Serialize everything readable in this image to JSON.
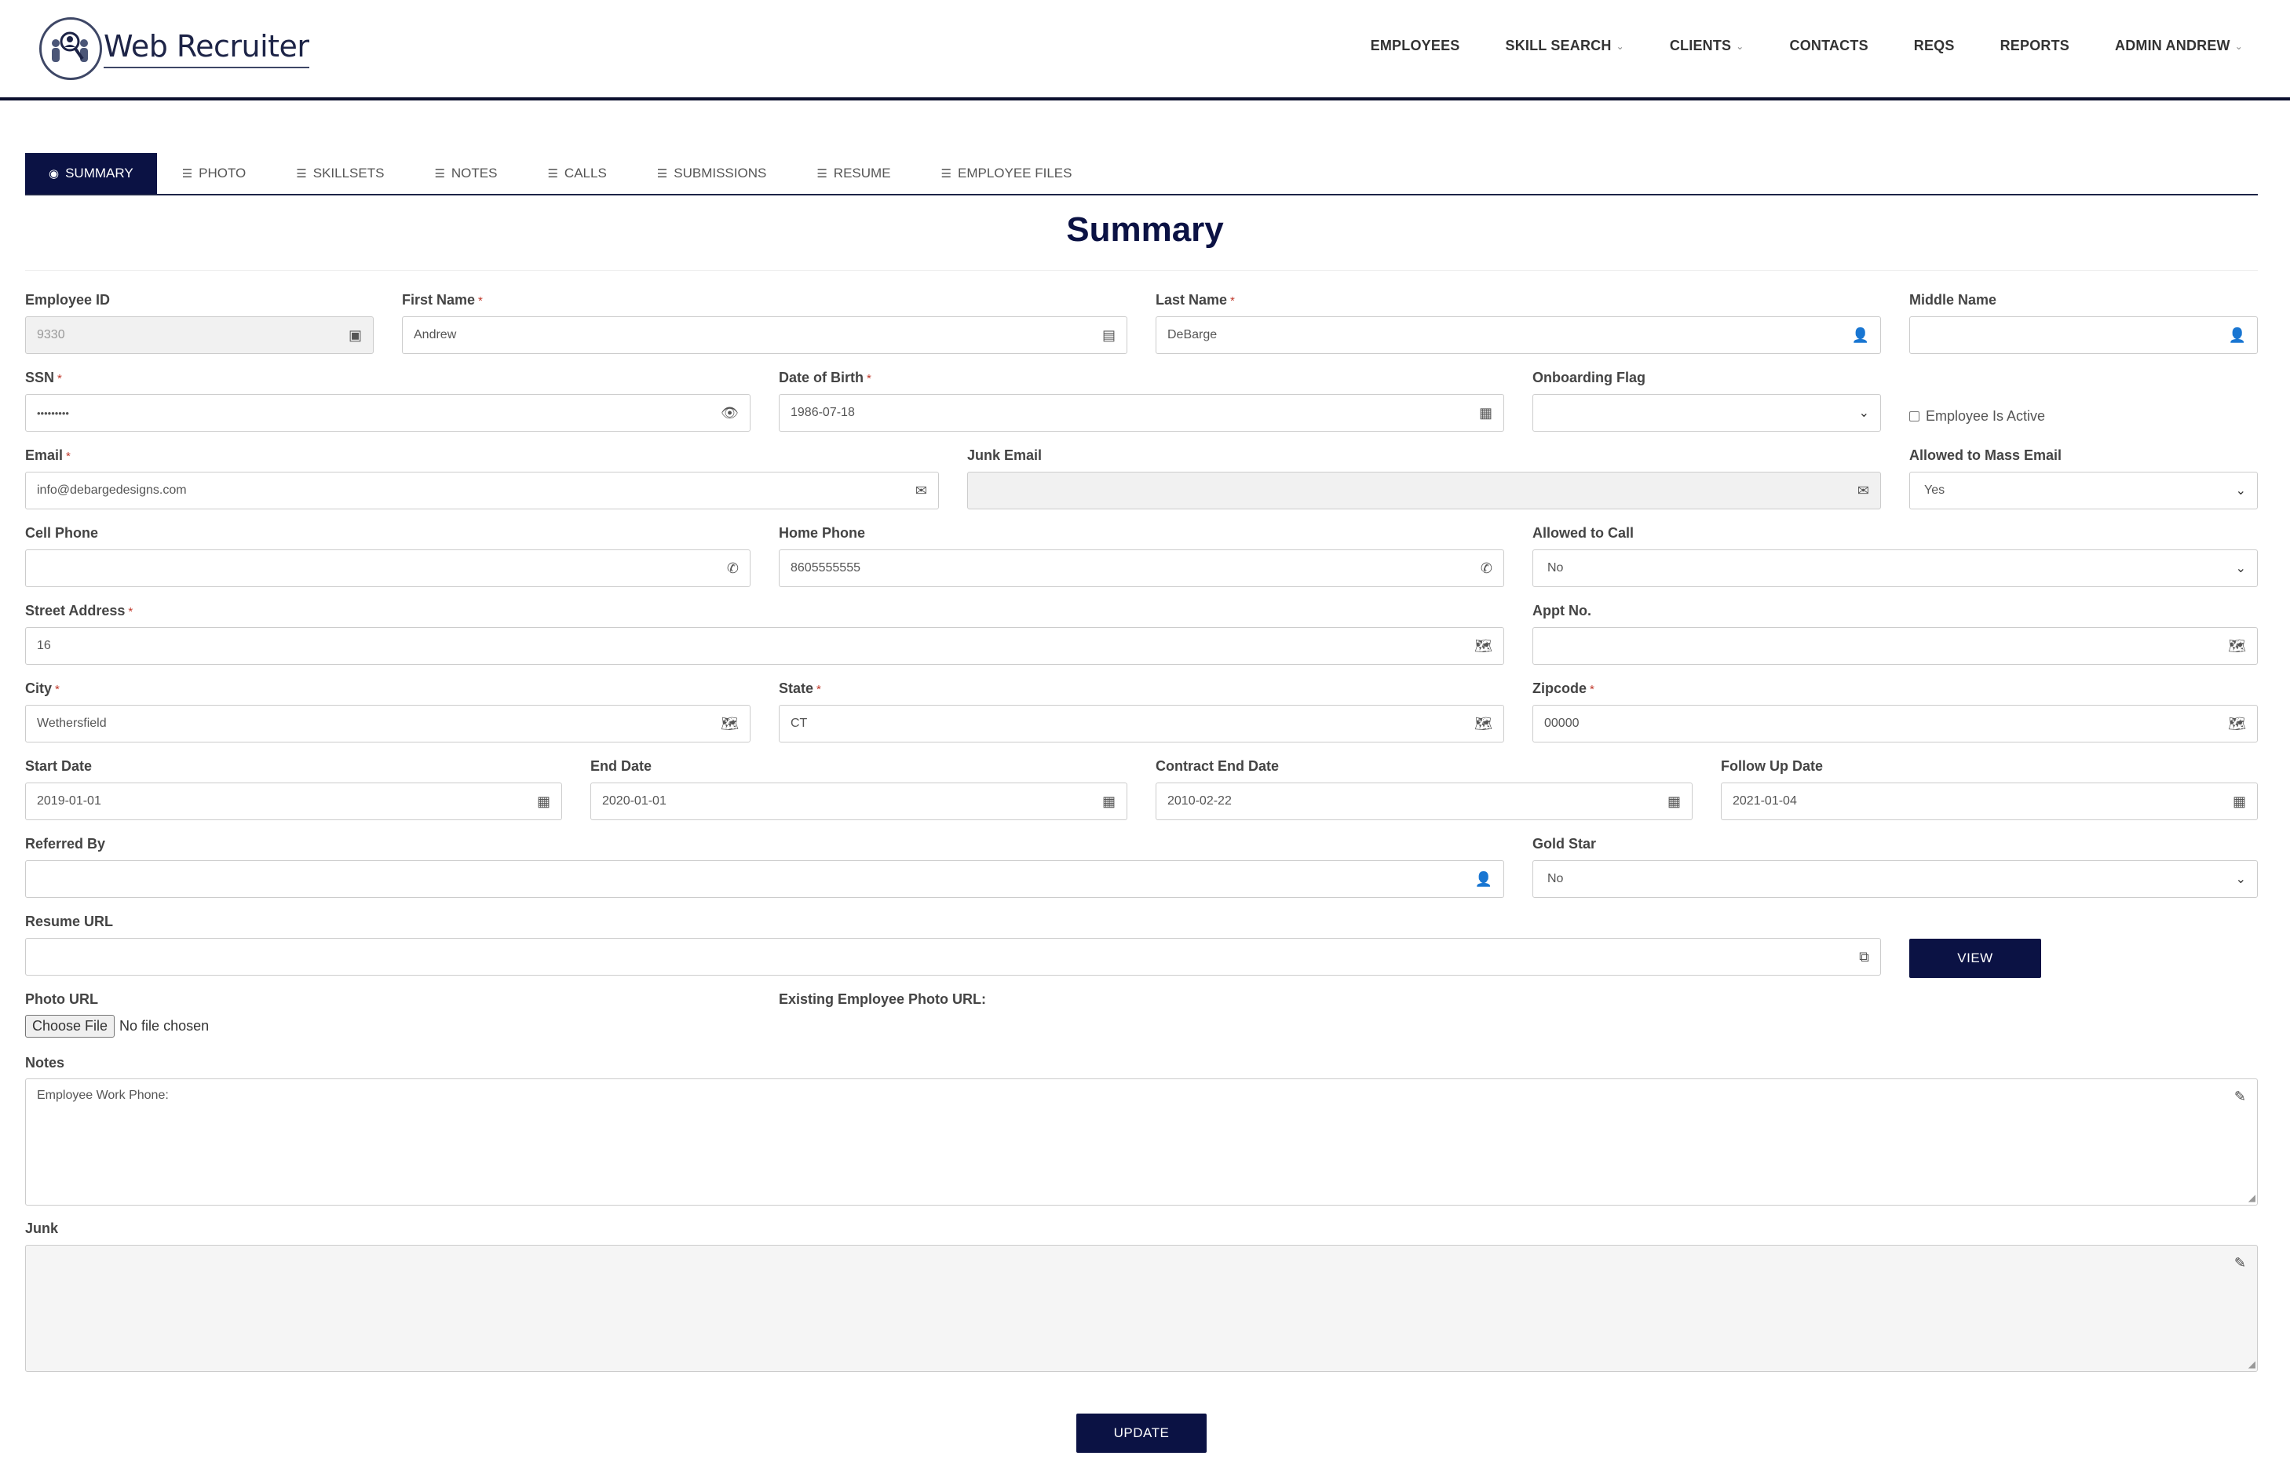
{
  "app": {
    "name": "Web Recruiter"
  },
  "nav": [
    {
      "label": "EMPLOYEES",
      "dropdown": false
    },
    {
      "label": "SKILL SEARCH",
      "dropdown": true
    },
    {
      "label": "CLIENTS",
      "dropdown": true
    },
    {
      "label": "CONTACTS",
      "dropdown": false
    },
    {
      "label": "REQS",
      "dropdown": false
    },
    {
      "label": "REPORTS",
      "dropdown": false
    },
    {
      "label": "ADMIN ANDREW",
      "dropdown": true
    }
  ],
  "tabs": [
    {
      "label": "SUMMARY",
      "icon": "user-circle-icon",
      "active": true
    },
    {
      "label": "PHOTO",
      "icon": "list-icon"
    },
    {
      "label": "SKILLSETS",
      "icon": "list-icon"
    },
    {
      "label": "NOTES",
      "icon": "list-icon"
    },
    {
      "label": "CALLS",
      "icon": "list-icon"
    },
    {
      "label": "SUBMISSIONS",
      "icon": "list-icon"
    },
    {
      "label": "RESUME",
      "icon": "list-icon"
    },
    {
      "label": "EMPLOYEE FILES",
      "icon": "list-icon"
    }
  ],
  "page_title": "Summary",
  "required_mark": "*",
  "fields": {
    "employee_id": {
      "label": "Employee ID",
      "value": "9330",
      "icon": "id-badge-icon"
    },
    "first_name": {
      "label": "First Name",
      "value": "Andrew",
      "icon": "id-card-icon"
    },
    "last_name": {
      "label": "Last Name",
      "value": "DeBarge",
      "icon": "user-icon"
    },
    "middle_name": {
      "label": "Middle Name",
      "value": "",
      "icon": "user-icon"
    },
    "ssn": {
      "label": "SSN",
      "value": "•••••••••",
      "icon": "eye-slash-icon"
    },
    "dob": {
      "label": "Date of Birth",
      "value": "1986-07-18",
      "icon": "calendar-icon"
    },
    "onboarding_flag": {
      "label": "Onboarding Flag",
      "value": ""
    },
    "employee_active": {
      "label": "Employee Is Active",
      "checked": false
    },
    "email": {
      "label": "Email",
      "value": "info@debargedesigns.com",
      "icon": "envelope-icon"
    },
    "junk_email": {
      "label": "Junk Email",
      "value": "",
      "icon": "envelope-icon"
    },
    "allowed_mass_email": {
      "label": "Allowed to Mass Email",
      "value": "Yes"
    },
    "cell_phone": {
      "label": "Cell Phone",
      "value": "",
      "icon": "phone-icon"
    },
    "home_phone": {
      "label": "Home Phone",
      "value": "8605555555",
      "icon": "phone-icon"
    },
    "allowed_call": {
      "label": "Allowed to Call",
      "value": "No"
    },
    "street": {
      "label": "Street Address",
      "value": "16",
      "icon": "map-icon"
    },
    "appt": {
      "label": "Appt No.",
      "value": "",
      "icon": "map-icon"
    },
    "city": {
      "label": "City",
      "value": "Wethersfield",
      "icon": "map-icon"
    },
    "state": {
      "label": "State",
      "value": "CT",
      "icon": "map-icon"
    },
    "zipcode": {
      "label": "Zipcode",
      "value": "00000",
      "icon": "map-icon"
    },
    "start_date": {
      "label": "Start Date",
      "value": "2019-01-01",
      "icon": "calendar-icon"
    },
    "end_date": {
      "label": "End Date",
      "value": "2020-01-01",
      "icon": "calendar-icon"
    },
    "contract_end_date": {
      "label": "Contract End Date",
      "value": "2010-02-22",
      "icon": "calendar-icon"
    },
    "follow_up_date": {
      "label": "Follow Up Date",
      "value": "2021-01-04",
      "icon": "calendar-icon"
    },
    "referred_by": {
      "label": "Referred By",
      "value": "",
      "icon": "user-icon"
    },
    "gold_star": {
      "label": "Gold Star",
      "value": "No"
    },
    "resume_url": {
      "label": "Resume URL",
      "value": "",
      "icon": "external-link-icon"
    },
    "photo_url": {
      "label": "Photo URL",
      "button": "Choose File",
      "status": "No file chosen"
    },
    "existing_photo_url": {
      "label": "Existing Employee Photo URL:"
    },
    "notes": {
      "label": "Notes",
      "value": "Employee Work Phone:",
      "icon": "pencil-icon"
    },
    "junk": {
      "label": "Junk",
      "value": "",
      "icon": "pencil-icon"
    }
  },
  "buttons": {
    "view": "VIEW",
    "update": "UPDATE"
  },
  "colors": {
    "primary": "#0b1244",
    "required": "#c0392b"
  }
}
